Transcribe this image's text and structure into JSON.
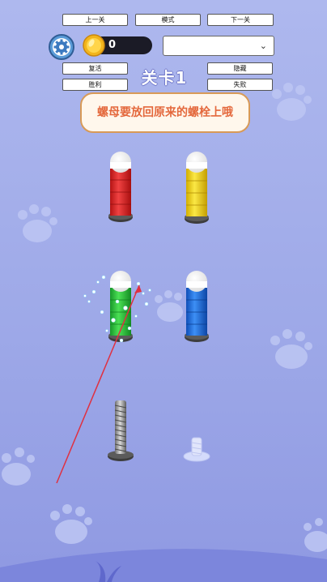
{
  "debug_buttons": {
    "prev": "上一关",
    "mode": "模式",
    "next": "下一关",
    "revive": "复活",
    "hide": "隐藏",
    "win": "胜利",
    "fail": "失败"
  },
  "coins": {
    "count": "0"
  },
  "level": {
    "title": "关卡1"
  },
  "hint": {
    "text": "螺母要放回原来的螺栓上哦"
  },
  "dropdown": {
    "value": ""
  },
  "bolts": [
    {
      "id": "red",
      "color": "#e02a2a",
      "nuts": 4,
      "cap": "white"
    },
    {
      "id": "yellow",
      "color": "#f3d21c",
      "nuts": 4,
      "cap": "white"
    },
    {
      "id": "green",
      "color": "#2bc233",
      "nuts": 4,
      "cap": "white",
      "state": "bubbling"
    },
    {
      "id": "blue",
      "color": "#1d6fe0",
      "nuts": 4,
      "cap": "white"
    },
    {
      "id": "grey-screw",
      "color": "#9a9a9a",
      "nuts": 0,
      "cap": "none"
    },
    {
      "id": "empty-base",
      "color": "#dfe6ff",
      "nuts": 0,
      "cap": "none"
    }
  ],
  "colors": {
    "accent_arrow": "#e03040",
    "hint_text": "#e4683c",
    "background": "#9ea9e8"
  }
}
